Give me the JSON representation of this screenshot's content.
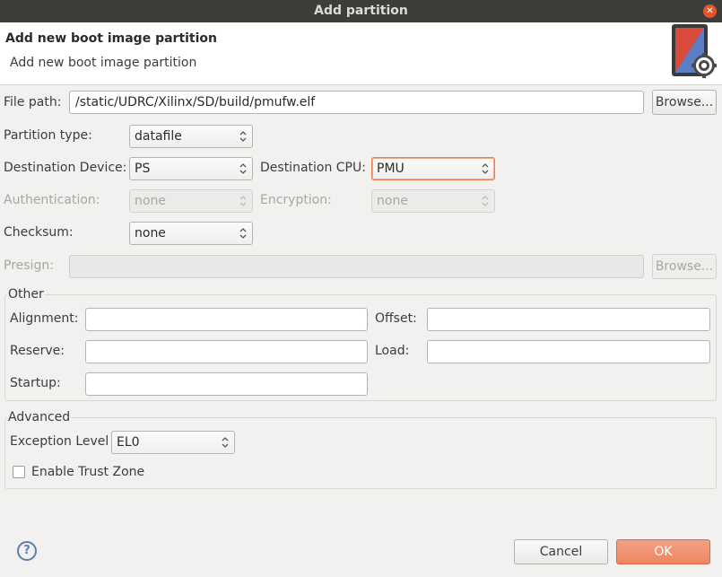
{
  "window": {
    "title": "Add partition"
  },
  "header": {
    "title": "Add new boot image partition",
    "description": "Add new boot image partition"
  },
  "form": {
    "file_path": {
      "label": "File path:",
      "value": "/static/UDRC/Xilinx/SD/build/pmufw.elf",
      "browse_label": "Browse..."
    },
    "partition_type": {
      "label": "Partition type:",
      "value": "datafile"
    },
    "destination_device": {
      "label": "Destination Device:",
      "value": "PS"
    },
    "destination_cpu": {
      "label": "Destination CPU:",
      "value": "PMU"
    },
    "authentication": {
      "label": "Authentication:",
      "value": "none"
    },
    "encryption": {
      "label": "Encryption:",
      "value": "none"
    },
    "checksum": {
      "label": "Checksum:",
      "value": "none"
    },
    "presign": {
      "label": "Presign:",
      "value": "",
      "browse_label": "Browse..."
    }
  },
  "other": {
    "title": "Other",
    "alignment_label": "Alignment:",
    "alignment_value": "",
    "offset_label": "Offset:",
    "offset_value": "",
    "reserve_label": "Reserve:",
    "reserve_value": "",
    "load_label": "Load:",
    "load_value": "",
    "startup_label": "Startup:",
    "startup_value": ""
  },
  "advanced": {
    "title": "Advanced",
    "exception_level_label": "Exception Level",
    "exception_level_value": "EL0",
    "trust_zone_label": "Enable Trust Zone",
    "trust_zone_checked": false
  },
  "footer": {
    "help_glyph": "?",
    "cancel_label": "Cancel",
    "ok_label": "OK"
  },
  "colors": {
    "accent": "#ee8560",
    "titlebar": "#3d3d3a",
    "close": "#e4562a"
  },
  "icons": {
    "close": "close-icon",
    "help": "help-icon",
    "banner": "boot-image-gear-icon"
  }
}
